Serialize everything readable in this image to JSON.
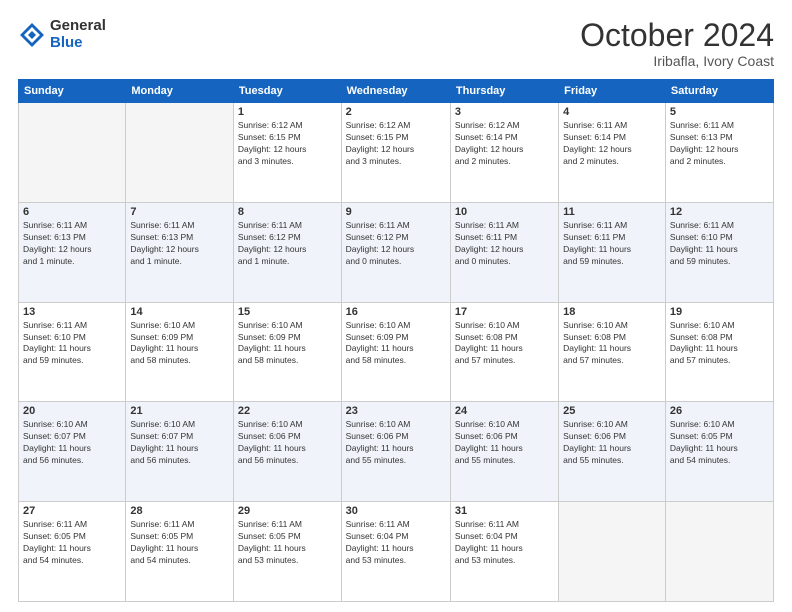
{
  "logo": {
    "general": "General",
    "blue": "Blue"
  },
  "header": {
    "month": "October 2024",
    "location": "Iribafla, Ivory Coast"
  },
  "weekdays": [
    "Sunday",
    "Monday",
    "Tuesday",
    "Wednesday",
    "Thursday",
    "Friday",
    "Saturday"
  ],
  "weeks": [
    [
      {
        "day": "",
        "info": ""
      },
      {
        "day": "",
        "info": ""
      },
      {
        "day": "1",
        "info": "Sunrise: 6:12 AM\nSunset: 6:15 PM\nDaylight: 12 hours\nand 3 minutes."
      },
      {
        "day": "2",
        "info": "Sunrise: 6:12 AM\nSunset: 6:15 PM\nDaylight: 12 hours\nand 3 minutes."
      },
      {
        "day": "3",
        "info": "Sunrise: 6:12 AM\nSunset: 6:14 PM\nDaylight: 12 hours\nand 2 minutes."
      },
      {
        "day": "4",
        "info": "Sunrise: 6:11 AM\nSunset: 6:14 PM\nDaylight: 12 hours\nand 2 minutes."
      },
      {
        "day": "5",
        "info": "Sunrise: 6:11 AM\nSunset: 6:13 PM\nDaylight: 12 hours\nand 2 minutes."
      }
    ],
    [
      {
        "day": "6",
        "info": "Sunrise: 6:11 AM\nSunset: 6:13 PM\nDaylight: 12 hours\nand 1 minute."
      },
      {
        "day": "7",
        "info": "Sunrise: 6:11 AM\nSunset: 6:13 PM\nDaylight: 12 hours\nand 1 minute."
      },
      {
        "day": "8",
        "info": "Sunrise: 6:11 AM\nSunset: 6:12 PM\nDaylight: 12 hours\nand 1 minute."
      },
      {
        "day": "9",
        "info": "Sunrise: 6:11 AM\nSunset: 6:12 PM\nDaylight: 12 hours\nand 0 minutes."
      },
      {
        "day": "10",
        "info": "Sunrise: 6:11 AM\nSunset: 6:11 PM\nDaylight: 12 hours\nand 0 minutes."
      },
      {
        "day": "11",
        "info": "Sunrise: 6:11 AM\nSunset: 6:11 PM\nDaylight: 11 hours\nand 59 minutes."
      },
      {
        "day": "12",
        "info": "Sunrise: 6:11 AM\nSunset: 6:10 PM\nDaylight: 11 hours\nand 59 minutes."
      }
    ],
    [
      {
        "day": "13",
        "info": "Sunrise: 6:11 AM\nSunset: 6:10 PM\nDaylight: 11 hours\nand 59 minutes."
      },
      {
        "day": "14",
        "info": "Sunrise: 6:10 AM\nSunset: 6:09 PM\nDaylight: 11 hours\nand 58 minutes."
      },
      {
        "day": "15",
        "info": "Sunrise: 6:10 AM\nSunset: 6:09 PM\nDaylight: 11 hours\nand 58 minutes."
      },
      {
        "day": "16",
        "info": "Sunrise: 6:10 AM\nSunset: 6:09 PM\nDaylight: 11 hours\nand 58 minutes."
      },
      {
        "day": "17",
        "info": "Sunrise: 6:10 AM\nSunset: 6:08 PM\nDaylight: 11 hours\nand 57 minutes."
      },
      {
        "day": "18",
        "info": "Sunrise: 6:10 AM\nSunset: 6:08 PM\nDaylight: 11 hours\nand 57 minutes."
      },
      {
        "day": "19",
        "info": "Sunrise: 6:10 AM\nSunset: 6:08 PM\nDaylight: 11 hours\nand 57 minutes."
      }
    ],
    [
      {
        "day": "20",
        "info": "Sunrise: 6:10 AM\nSunset: 6:07 PM\nDaylight: 11 hours\nand 56 minutes."
      },
      {
        "day": "21",
        "info": "Sunrise: 6:10 AM\nSunset: 6:07 PM\nDaylight: 11 hours\nand 56 minutes."
      },
      {
        "day": "22",
        "info": "Sunrise: 6:10 AM\nSunset: 6:06 PM\nDaylight: 11 hours\nand 56 minutes."
      },
      {
        "day": "23",
        "info": "Sunrise: 6:10 AM\nSunset: 6:06 PM\nDaylight: 11 hours\nand 55 minutes."
      },
      {
        "day": "24",
        "info": "Sunrise: 6:10 AM\nSunset: 6:06 PM\nDaylight: 11 hours\nand 55 minutes."
      },
      {
        "day": "25",
        "info": "Sunrise: 6:10 AM\nSunset: 6:06 PM\nDaylight: 11 hours\nand 55 minutes."
      },
      {
        "day": "26",
        "info": "Sunrise: 6:10 AM\nSunset: 6:05 PM\nDaylight: 11 hours\nand 54 minutes."
      }
    ],
    [
      {
        "day": "27",
        "info": "Sunrise: 6:11 AM\nSunset: 6:05 PM\nDaylight: 11 hours\nand 54 minutes."
      },
      {
        "day": "28",
        "info": "Sunrise: 6:11 AM\nSunset: 6:05 PM\nDaylight: 11 hours\nand 54 minutes."
      },
      {
        "day": "29",
        "info": "Sunrise: 6:11 AM\nSunset: 6:05 PM\nDaylight: 11 hours\nand 53 minutes."
      },
      {
        "day": "30",
        "info": "Sunrise: 6:11 AM\nSunset: 6:04 PM\nDaylight: 11 hours\nand 53 minutes."
      },
      {
        "day": "31",
        "info": "Sunrise: 6:11 AM\nSunset: 6:04 PM\nDaylight: 11 hours\nand 53 minutes."
      },
      {
        "day": "",
        "info": ""
      },
      {
        "day": "",
        "info": ""
      }
    ]
  ]
}
